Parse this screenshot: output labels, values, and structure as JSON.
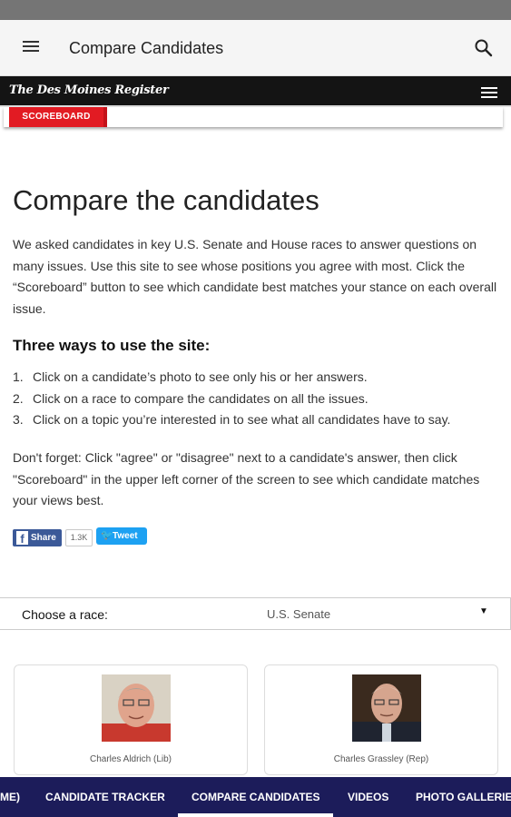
{
  "app_bar": {
    "title": "Compare Candidates"
  },
  "publisher": {
    "logo_text": "The Des Moines Register"
  },
  "scoreboard": {
    "label": "SCOREBOARD"
  },
  "main": {
    "heading": "Compare the candidates",
    "intro": "We asked candidates in key U.S. Senate and House races to answer questions on many issues. Use this site to see whose positions you agree with most. Click the “Scoreboard” button to see which candidate best matches your stance on each overall issue.",
    "ways_heading": "Three ways to use the site:",
    "ways": [
      {
        "num": "1.",
        "text": "Click on a candidate’s photo to see only his or her answers."
      },
      {
        "num": "2.",
        "text": "Click on a race to compare the candidates on all the issues."
      },
      {
        "num": "3.",
        "text": "Click on a topic you’re interested in to see what all candidates have to say."
      }
    ],
    "forget": "Don't forget: Click \"agree\" or \"disagree\" next to a candidate's answer, then click \"Scoreboard\" in the upper left corner of the screen to see which candidate matches your views best."
  },
  "share": {
    "facebook_label": "Share",
    "facebook_count": "1.3K",
    "twitter_label": "Tweet"
  },
  "race": {
    "label": "Choose a race:",
    "value": "U.S. Senate"
  },
  "candidates": [
    {
      "name": "Charles Aldrich (Lib)"
    },
    {
      "name": "Charles Grassley (Rep)"
    }
  ],
  "nav": {
    "items": [
      {
        "label": "ME)"
      },
      {
        "label": "CANDIDATE TRACKER"
      },
      {
        "label": "COMPARE CANDIDATES"
      },
      {
        "label": "VIDEOS"
      },
      {
        "label": "PHOTO GALLERIES"
      }
    ]
  }
}
